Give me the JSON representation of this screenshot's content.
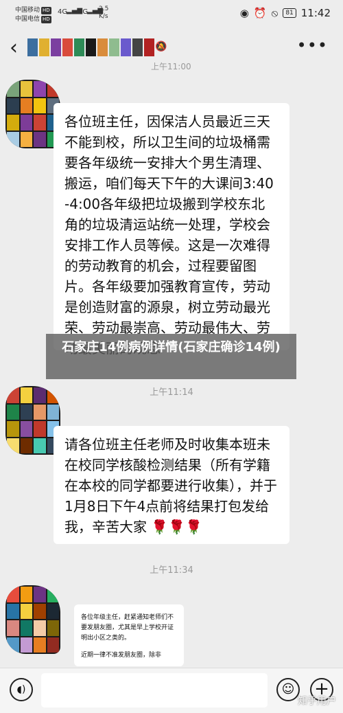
{
  "status_bar": {
    "carrier1": "中国移动",
    "carrier2": "中国电信",
    "hd": "HD",
    "signal1": "4G",
    "signal2": "4G",
    "speed_value": "2.5",
    "speed_unit": "K/s",
    "battery": "81",
    "time": "11:42"
  },
  "header": {
    "back_icon": "chevron-left-icon",
    "more_icon": "more-dots-icon",
    "mute_icon": "mute-bell-icon",
    "title_obscured": true,
    "partial_time": "上午11:00"
  },
  "messages": [
    {
      "text": "各位班主任，因保洁人员最近三天不能到校，所以卫生间的垃圾桶需要各年级统一安排大个男生清理、搬运，咱们每天下午的大课间3:40-4:00各年级把垃圾搬到学校东北角的垃圾清运站统一处理，学校会安排工作人员等候。这是一次难得的劳动教育的机会，过程要留图片。各年级要加强教育宣传，劳动是创造财富的源泉，树立劳动最光荣、劳动最崇高、劳动最伟大、劳动最美丽的观念"
    },
    {
      "time": "上午11:14"
    },
    {
      "text": "请各位班主任老师及时收集本班未在校同学核酸检测结果（所有学籍在本校的同学都要进行收集），并于1月8日下午4点前将结果打包发给我，辛苦大家",
      "emoji": "🌹🌹🌹"
    },
    {
      "time": "上午11:34"
    },
    {
      "line1": "各位年级主任，赶紧通知老师们不要发朋友圈，尤其是早上学校开证明出小区之类的。",
      "line2": "近期一律不准发朋友圈，除非"
    }
  ],
  "overlay_caption": "石家庄14例病例详情(石家庄确诊14例)",
  "watermark": "知乎用户",
  "input_bar": {
    "voice_icon": "voice-icon",
    "emoji_icon": "emoji-icon",
    "plus_icon": "plus-icon",
    "input_value": ""
  },
  "colors": {
    "background": "#ededed",
    "bubble": "#ffffff",
    "timestamp": "#999999",
    "overlay": "#5a5a5a"
  }
}
